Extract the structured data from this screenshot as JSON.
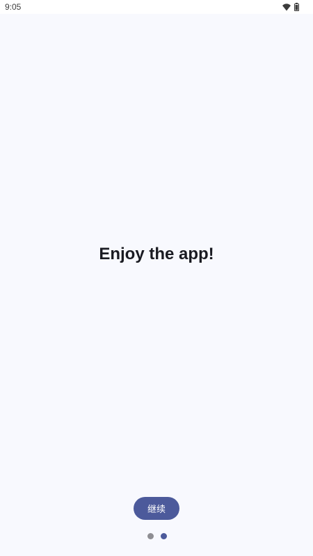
{
  "status_bar": {
    "time": "9:05",
    "icons": [
      "wifi-icon",
      "battery-icon"
    ]
  },
  "main": {
    "title": "Enjoy the app!"
  },
  "footer": {
    "continue_label": "继续",
    "page_indicator": {
      "total_pages": 2,
      "current_page": 2
    }
  },
  "colors": {
    "background": "#F8F9FE",
    "button": "#4C5A9B",
    "dot_inactive": "#8E8E93",
    "dot_active": "#4C5A9B",
    "title_text": "#1A1B22"
  }
}
